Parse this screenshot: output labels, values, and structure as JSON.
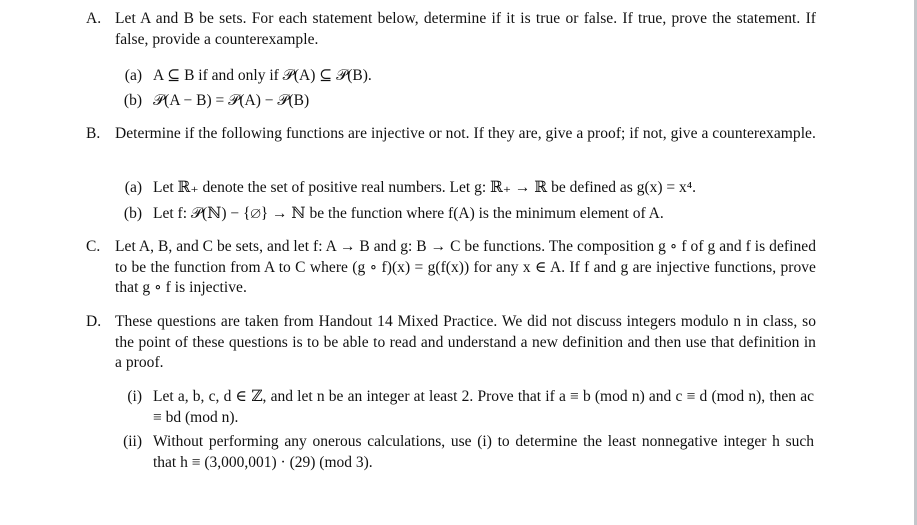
{
  "problems": [
    {
      "label": "A.",
      "text": "Let A and B be sets. For each statement below, determine if it is true or false. If true, prove the statement. If false, provide a counterexample.",
      "parts": [
        {
          "label": "(a)",
          "text": "A ⊆ B if and only if 𝒫(A) ⊆ 𝒫(B)."
        },
        {
          "label": "(b)",
          "text": "𝒫(A − B) = 𝒫(A) − 𝒫(B)"
        }
      ]
    },
    {
      "label": "B.",
      "text": "Determine if the following functions are injective or not. If they are, give a proof; if not, give a counterexample.",
      "parts": [
        {
          "label": "(a)",
          "text": "Let ℝ₊ denote the set of positive real numbers. Let g: ℝ₊ → ℝ be defined as g(x) = x⁴."
        },
        {
          "label": "(b)",
          "text": "Let f: 𝒫(ℕ) − {∅} → ℕ be the function where f(A) is the minimum element of A."
        }
      ]
    },
    {
      "label": "C.",
      "text": "Let A, B, and C be sets, and let f: A → B and g: B → C be functions. The composition g ∘ f of g and f is defined to be the function from A to C where (g ∘ f)(x) = g(f(x)) for any x ∈ A. If f and g are injective functions, prove that g ∘ f is injective.",
      "parts": []
    },
    {
      "label": "D.",
      "text": "These questions are taken from Handout 14 Mixed Practice. We did not discuss integers modulo n in class, so the point of these questions is to be able to read and understand a new definition and then use that definition in a proof.",
      "parts": [
        {
          "label": "(i)",
          "text": "Let a, b, c, d ∈ ℤ, and let n be an integer at least 2. Prove that if a ≡ b (mod n) and c ≡ d (mod n), then ac ≡ bd (mod n)."
        },
        {
          "label": "(ii)",
          "text": "Without performing any onerous calculations, use (i) to determine the least nonnegative integer h such that h ≡ (3,000,001) · (29) (mod 3)."
        }
      ]
    }
  ]
}
